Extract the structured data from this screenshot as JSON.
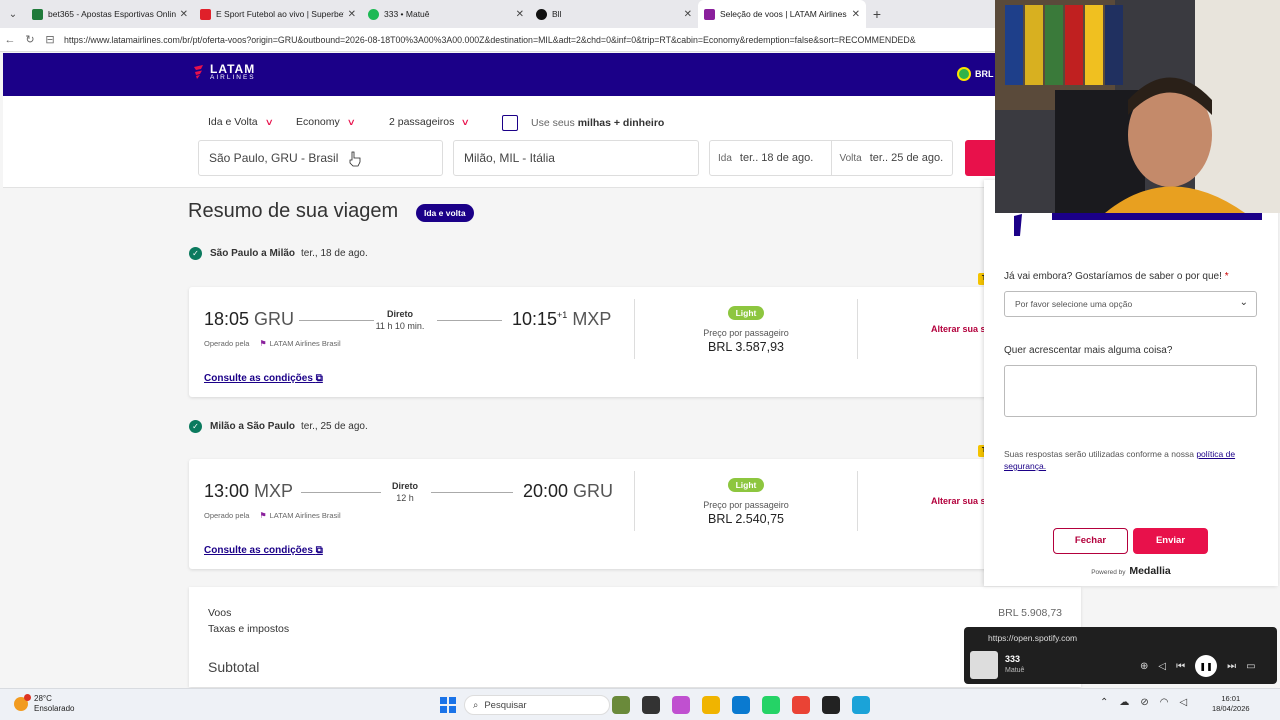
{
  "browser": {
    "tabs": [
      {
        "title": "bet365 - Apostas Esportivas Online",
        "color": "#1f7a3a"
      },
      {
        "title": "E Sport Futebol ao vivo | Superbet",
        "color": "#e0202a"
      },
      {
        "title": "333 • Matuê",
        "color": "#1db954"
      },
      {
        "title": "Bll",
        "color": "#111111"
      },
      {
        "title": "Seleção de voos | LATAM Airlines",
        "color": "#8a1f9c"
      }
    ],
    "url": "https://www.latamairlines.com/br/pt/oferta-voos?origin=GRU&outbound=2026-08-18T00%3A00%3A00.000Z&destination=MIL&adt=2&chd=0&inf=0&trip=RT&cabin=Economy&redemption=false&sort=RECOMMENDED&"
  },
  "header": {
    "logo_main": "LATAM",
    "logo_sub": "AIRLINES",
    "currency": "BRL -",
    "brand_color": "#1b0088"
  },
  "search": {
    "trip_type": "Ida e Volta",
    "cabin": "Economy",
    "passengers": "2 passageiros",
    "miles_prefix": "Use seus",
    "miles_bold": "milhas + dinheiro",
    "origin": "São Paulo, GRU - Brasil",
    "destination": "Milão, MIL - Itália",
    "outbound_label": "Ida",
    "outbound_date": "ter.. 18 de ago.",
    "return_label": "Volta",
    "return_date": "ter.. 25 de ago."
  },
  "summary": {
    "title": "Resumo de sua viagem",
    "badge": "Ida e volta"
  },
  "segments": [
    {
      "route": "São Paulo a Milão",
      "date": "ter., 18 de ago.",
      "dep_time": "18:05",
      "dep_airport": "GRU",
      "arr_time": "10:15",
      "arr_plus": "+1",
      "arr_airport": "MXP",
      "stops": "Direto",
      "duration": "11 h 10 min.",
      "operated_label": "Operado pela",
      "operator": "LATAM Airlines Brasil",
      "fare_brand": "Light",
      "price_label": "Preço por passageiro",
      "price": "BRL 3.587,93",
      "change_link": "Alterar sua s",
      "conditions": "Consulte as condições"
    },
    {
      "route": "Milão a São Paulo",
      "date": "ter., 25 de ago.",
      "dep_time": "13:00",
      "dep_airport": "MXP",
      "arr_time": "20:00",
      "arr_plus": "",
      "arr_airport": "GRU",
      "stops": "Direto",
      "duration": "12 h",
      "operated_label": "Operado pela",
      "operator": "LATAM Airlines Brasil",
      "fare_brand": "Light",
      "price_label": "Preço por passageiro",
      "price": "BRL 2.540,75",
      "change_link": "Alterar sua s",
      "conditions": "Consulte as condições"
    }
  ],
  "costs": {
    "flights_label": "Voos",
    "flights_value": "BRL 5.908,73",
    "taxes_label": "Taxas e impostos",
    "subtotal_label": "Subtotal"
  },
  "feedback": {
    "question1": "Já vai embora? Gostaríamos de saber o por que!",
    "required_mark": "*",
    "select_placeholder": "Por favor selecione uma opção",
    "question2": "Quer acrescentar mais alguma coisa?",
    "note_prefix": "Suas respostas serão utilizadas conforme a nossa",
    "note_link": "política de segurança.",
    "close_label": "Fechar",
    "send_label": "Enviar",
    "powered_by": "Powered by",
    "powered_brand": "Medallia"
  },
  "spotify": {
    "url": "https://open.spotify.com",
    "song": "333",
    "artist": "Matuê"
  },
  "taskbar": {
    "temperature": "28°C",
    "condition": "Ensolarado",
    "search": "Pesquisar",
    "time": "16:01",
    "date": "18/04/2026"
  },
  "colors": {
    "accent": "#e8114b",
    "light_fare": "#8dc63f",
    "check": "#0b7a5e"
  },
  "icons": [
    "tab-menu-icon",
    "close-icon",
    "new-tab-icon",
    "back-icon",
    "reload-icon",
    "site-info-icon",
    "chevron-down-icon",
    "check-icon",
    "plane-icon",
    "external-link-icon",
    "play-pause-icon",
    "windows-start-icon",
    "search-icon"
  ]
}
